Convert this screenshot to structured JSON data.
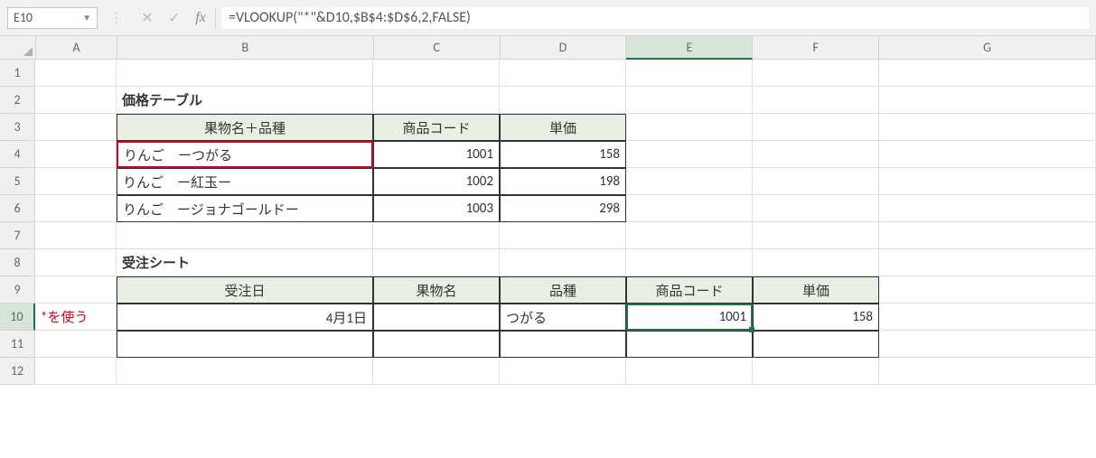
{
  "formula_bar": {
    "cell_ref": "E10",
    "formula": "=VLOOKUP(\"*\"&D10,$B$4:$D$6,2,FALSE)"
  },
  "columns": [
    "A",
    "B",
    "C",
    "D",
    "E",
    "F",
    "G"
  ],
  "rows": [
    "1",
    "2",
    "3",
    "4",
    "5",
    "6",
    "7",
    "8",
    "9",
    "10",
    "11",
    "12"
  ],
  "active": {
    "col": "E",
    "row": "10"
  },
  "sheet": {
    "title1": "価格テーブル",
    "table1": {
      "headers": [
        "果物名＋品種",
        "商品コード",
        "単価"
      ],
      "rows": [
        {
          "name": "りんご　ーつがる",
          "code": "1001",
          "price": "158"
        },
        {
          "name": "りんご　ー紅玉ー",
          "code": "1002",
          "price": "198"
        },
        {
          "name": "りんご　ージョナゴールドー",
          "code": "1003",
          "price": "298"
        }
      ]
    },
    "title2": "受注シート",
    "table2": {
      "headers": [
        "受注日",
        "果物名",
        "品種",
        "商品コード",
        "単価"
      ],
      "rows": [
        {
          "note": "*を使う",
          "date": "4月1日",
          "fruit": "",
          "variety": "つがる",
          "code": "1001",
          "price": "158"
        }
      ]
    }
  }
}
